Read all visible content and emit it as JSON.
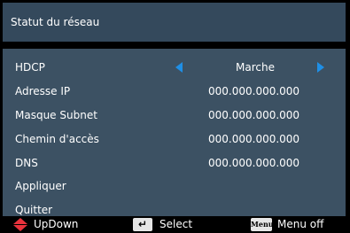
{
  "window": {
    "title": "Statut du réseau"
  },
  "settings": [
    {
      "label": "HDCP",
      "value": "Marche",
      "has_arrows": true
    },
    {
      "label": "Adresse IP",
      "value": "000.000.000.000"
    },
    {
      "label": "Masque Subnet",
      "value": "000.000.000.000"
    },
    {
      "label": "Chemin d'accès",
      "value": "000.000.000.000"
    },
    {
      "label": "DNS",
      "value": "000.000.000.000"
    },
    {
      "label": "Appliquer",
      "value": ""
    },
    {
      "label": "Quitter",
      "value": ""
    }
  ],
  "footer": {
    "updown_label": "UpDown",
    "select_label": "Select",
    "menu_key": "Menu",
    "menu_off_label": "Menu off"
  },
  "colors": {
    "title_bg": "#34495c",
    "panel_bg": "#3c5163",
    "arrow": "#1f8fe6",
    "updown_icon": "#e8323c"
  }
}
